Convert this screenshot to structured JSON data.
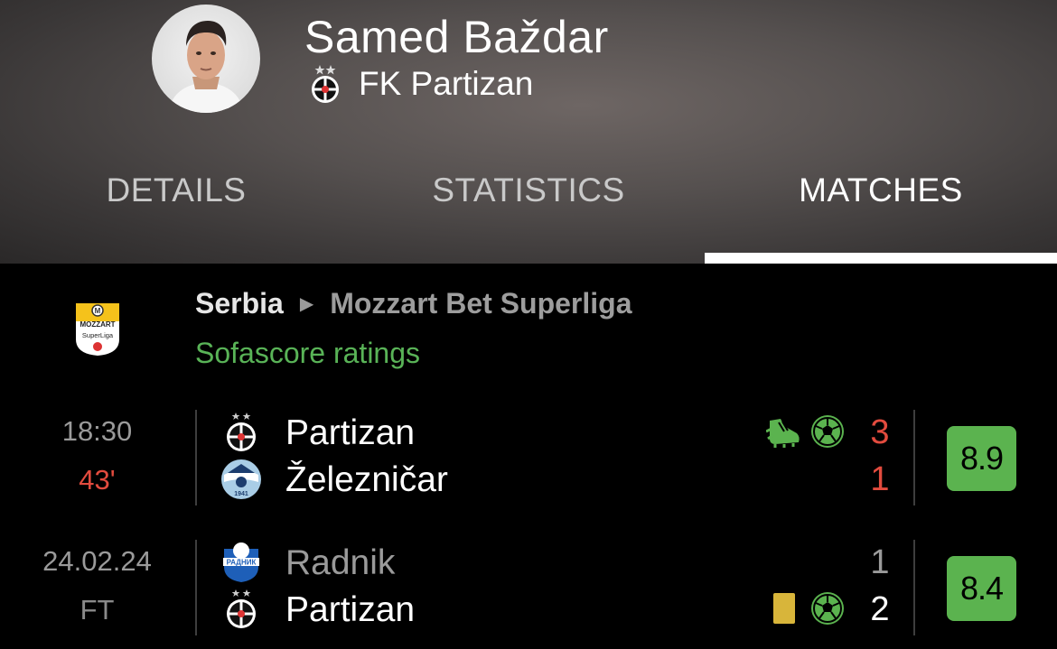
{
  "player": {
    "name": "Samed Baždar",
    "team": "FK Partizan"
  },
  "tabs": [
    {
      "label": "DETAILS",
      "active": false
    },
    {
      "label": "STATISTICS",
      "active": false
    },
    {
      "label": "MATCHES",
      "active": true
    }
  ],
  "league": {
    "country": "Serbia",
    "name": "Mozzart Bet Superliga",
    "ratings_label": "Sofascore ratings",
    "logo_text": [
      "MOZZART",
      "SuperLiga"
    ]
  },
  "matches": [
    {
      "time": "18:30",
      "status": "43'",
      "home": {
        "name": "Partizan",
        "score": "3"
      },
      "away": {
        "name": "Železničar",
        "score": "1"
      },
      "home_events": [
        "assist-boot-icon",
        "goal-ball-icon"
      ],
      "away_events": [],
      "rating": "8.9"
    },
    {
      "time": "24.02.24",
      "status": "FT",
      "home": {
        "name": "Radnik",
        "score": "1"
      },
      "away": {
        "name": "Partizan",
        "score": "2"
      },
      "home_events": [],
      "away_events": [
        "yellow-card-icon",
        "goal-ball-icon"
      ],
      "rating": "8.4"
    }
  ],
  "colors": {
    "accent_green": "#59b357",
    "rating_bg": "#5bb34f",
    "live_red": "#e24b3e",
    "yellow_card": "#d8b53a"
  }
}
